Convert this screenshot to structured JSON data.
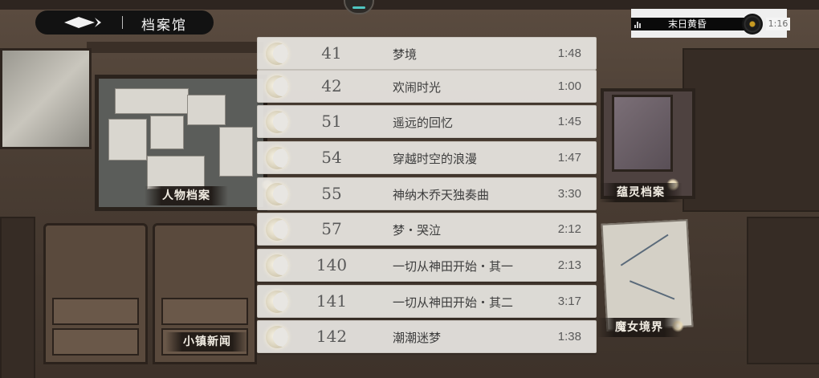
{
  "header": {
    "title": "档案馆"
  },
  "player": {
    "track": "末日黄昏",
    "time": "1:16"
  },
  "songs": [
    {
      "num": "41",
      "title": "梦境",
      "duration": "1:48"
    },
    {
      "num": "42",
      "title": "欢闹时光",
      "duration": "1:00"
    },
    {
      "num": "51",
      "title": "遥远的回忆",
      "duration": "1:45"
    },
    {
      "num": "54",
      "title": "穿越时空的浪漫",
      "duration": "1:47"
    },
    {
      "num": "55",
      "title": "神纳木乔天独奏曲",
      "duration": "3:30"
    },
    {
      "num": "57",
      "title": "梦・哭泣",
      "duration": "2:12"
    },
    {
      "num": "140",
      "title": "一切从神田开始・其一",
      "duration": "2:13"
    },
    {
      "num": "141",
      "title": "一切从神田开始・其二",
      "duration": "3:17"
    },
    {
      "num": "142",
      "title": "潮潮迷梦",
      "duration": "1:38"
    }
  ],
  "world_labels": {
    "characters": "人物档案",
    "spirits": "蕴灵档案",
    "news": "小镇新闻",
    "witch": "魔女境界"
  },
  "colors": {
    "row_bg": "#e8e6e2",
    "header_bg": "#121212",
    "moon": "#f7f3e6",
    "accent_teal": "#4fc6c2"
  }
}
